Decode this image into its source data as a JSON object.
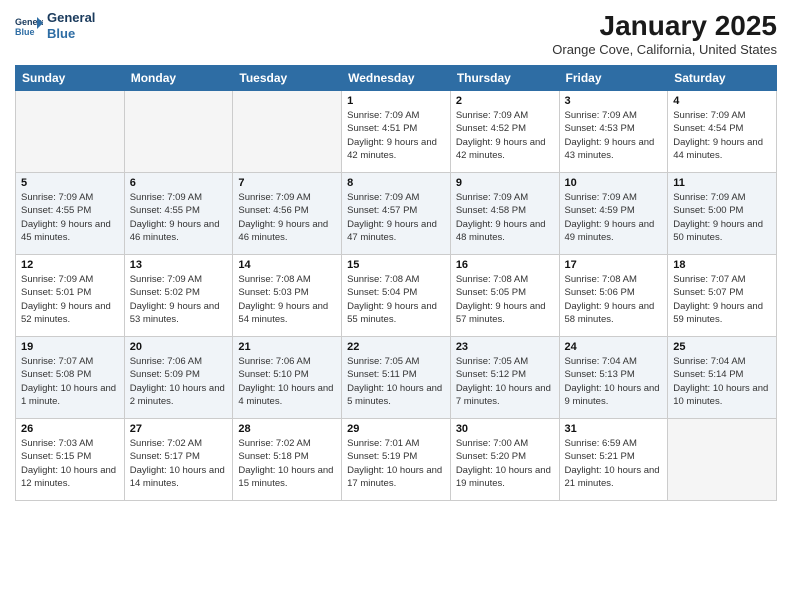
{
  "header": {
    "logo_line1": "General",
    "logo_line2": "Blue",
    "month": "January 2025",
    "location": "Orange Cove, California, United States"
  },
  "weekdays": [
    "Sunday",
    "Monday",
    "Tuesday",
    "Wednesday",
    "Thursday",
    "Friday",
    "Saturday"
  ],
  "weeks": [
    [
      {
        "day": "",
        "info": ""
      },
      {
        "day": "",
        "info": ""
      },
      {
        "day": "",
        "info": ""
      },
      {
        "day": "1",
        "info": "Sunrise: 7:09 AM\nSunset: 4:51 PM\nDaylight: 9 hours and 42 minutes."
      },
      {
        "day": "2",
        "info": "Sunrise: 7:09 AM\nSunset: 4:52 PM\nDaylight: 9 hours and 42 minutes."
      },
      {
        "day": "3",
        "info": "Sunrise: 7:09 AM\nSunset: 4:53 PM\nDaylight: 9 hours and 43 minutes."
      },
      {
        "day": "4",
        "info": "Sunrise: 7:09 AM\nSunset: 4:54 PM\nDaylight: 9 hours and 44 minutes."
      }
    ],
    [
      {
        "day": "5",
        "info": "Sunrise: 7:09 AM\nSunset: 4:55 PM\nDaylight: 9 hours and 45 minutes."
      },
      {
        "day": "6",
        "info": "Sunrise: 7:09 AM\nSunset: 4:55 PM\nDaylight: 9 hours and 46 minutes."
      },
      {
        "day": "7",
        "info": "Sunrise: 7:09 AM\nSunset: 4:56 PM\nDaylight: 9 hours and 46 minutes."
      },
      {
        "day": "8",
        "info": "Sunrise: 7:09 AM\nSunset: 4:57 PM\nDaylight: 9 hours and 47 minutes."
      },
      {
        "day": "9",
        "info": "Sunrise: 7:09 AM\nSunset: 4:58 PM\nDaylight: 9 hours and 48 minutes."
      },
      {
        "day": "10",
        "info": "Sunrise: 7:09 AM\nSunset: 4:59 PM\nDaylight: 9 hours and 49 minutes."
      },
      {
        "day": "11",
        "info": "Sunrise: 7:09 AM\nSunset: 5:00 PM\nDaylight: 9 hours and 50 minutes."
      }
    ],
    [
      {
        "day": "12",
        "info": "Sunrise: 7:09 AM\nSunset: 5:01 PM\nDaylight: 9 hours and 52 minutes."
      },
      {
        "day": "13",
        "info": "Sunrise: 7:09 AM\nSunset: 5:02 PM\nDaylight: 9 hours and 53 minutes."
      },
      {
        "day": "14",
        "info": "Sunrise: 7:08 AM\nSunset: 5:03 PM\nDaylight: 9 hours and 54 minutes."
      },
      {
        "day": "15",
        "info": "Sunrise: 7:08 AM\nSunset: 5:04 PM\nDaylight: 9 hours and 55 minutes."
      },
      {
        "day": "16",
        "info": "Sunrise: 7:08 AM\nSunset: 5:05 PM\nDaylight: 9 hours and 57 minutes."
      },
      {
        "day": "17",
        "info": "Sunrise: 7:08 AM\nSunset: 5:06 PM\nDaylight: 9 hours and 58 minutes."
      },
      {
        "day": "18",
        "info": "Sunrise: 7:07 AM\nSunset: 5:07 PM\nDaylight: 9 hours and 59 minutes."
      }
    ],
    [
      {
        "day": "19",
        "info": "Sunrise: 7:07 AM\nSunset: 5:08 PM\nDaylight: 10 hours and 1 minute."
      },
      {
        "day": "20",
        "info": "Sunrise: 7:06 AM\nSunset: 5:09 PM\nDaylight: 10 hours and 2 minutes."
      },
      {
        "day": "21",
        "info": "Sunrise: 7:06 AM\nSunset: 5:10 PM\nDaylight: 10 hours and 4 minutes."
      },
      {
        "day": "22",
        "info": "Sunrise: 7:05 AM\nSunset: 5:11 PM\nDaylight: 10 hours and 5 minutes."
      },
      {
        "day": "23",
        "info": "Sunrise: 7:05 AM\nSunset: 5:12 PM\nDaylight: 10 hours and 7 minutes."
      },
      {
        "day": "24",
        "info": "Sunrise: 7:04 AM\nSunset: 5:13 PM\nDaylight: 10 hours and 9 minutes."
      },
      {
        "day": "25",
        "info": "Sunrise: 7:04 AM\nSunset: 5:14 PM\nDaylight: 10 hours and 10 minutes."
      }
    ],
    [
      {
        "day": "26",
        "info": "Sunrise: 7:03 AM\nSunset: 5:15 PM\nDaylight: 10 hours and 12 minutes."
      },
      {
        "day": "27",
        "info": "Sunrise: 7:02 AM\nSunset: 5:17 PM\nDaylight: 10 hours and 14 minutes."
      },
      {
        "day": "28",
        "info": "Sunrise: 7:02 AM\nSunset: 5:18 PM\nDaylight: 10 hours and 15 minutes."
      },
      {
        "day": "29",
        "info": "Sunrise: 7:01 AM\nSunset: 5:19 PM\nDaylight: 10 hours and 17 minutes."
      },
      {
        "day": "30",
        "info": "Sunrise: 7:00 AM\nSunset: 5:20 PM\nDaylight: 10 hours and 19 minutes."
      },
      {
        "day": "31",
        "info": "Sunrise: 6:59 AM\nSunset: 5:21 PM\nDaylight: 10 hours and 21 minutes."
      },
      {
        "day": "",
        "info": ""
      }
    ]
  ]
}
